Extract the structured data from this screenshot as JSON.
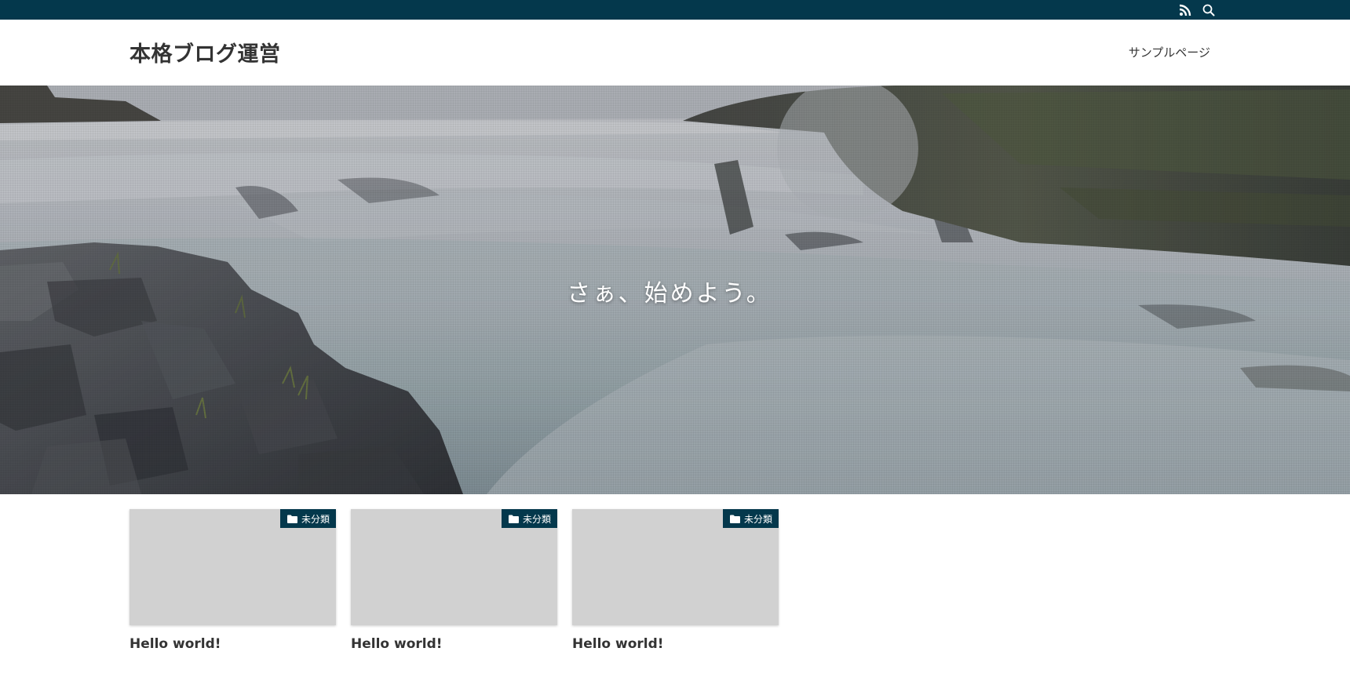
{
  "topbar": {
    "icons": [
      "rss-icon",
      "search-icon"
    ],
    "color": "#04384c"
  },
  "header": {
    "site_title": "本格ブログ運営",
    "nav": [
      {
        "label": "サンプルページ"
      }
    ]
  },
  "hero": {
    "catchphrase": "さぁ、始めよう。"
  },
  "posts": [
    {
      "category": "未分類",
      "title": "Hello world!"
    },
    {
      "category": "未分類",
      "title": "Hello world!"
    },
    {
      "category": "未分類",
      "title": "Hello world!"
    }
  ],
  "colors": {
    "accent": "#04384c",
    "thumb_placeholder": "#d1d1d1",
    "text": "#333333"
  }
}
